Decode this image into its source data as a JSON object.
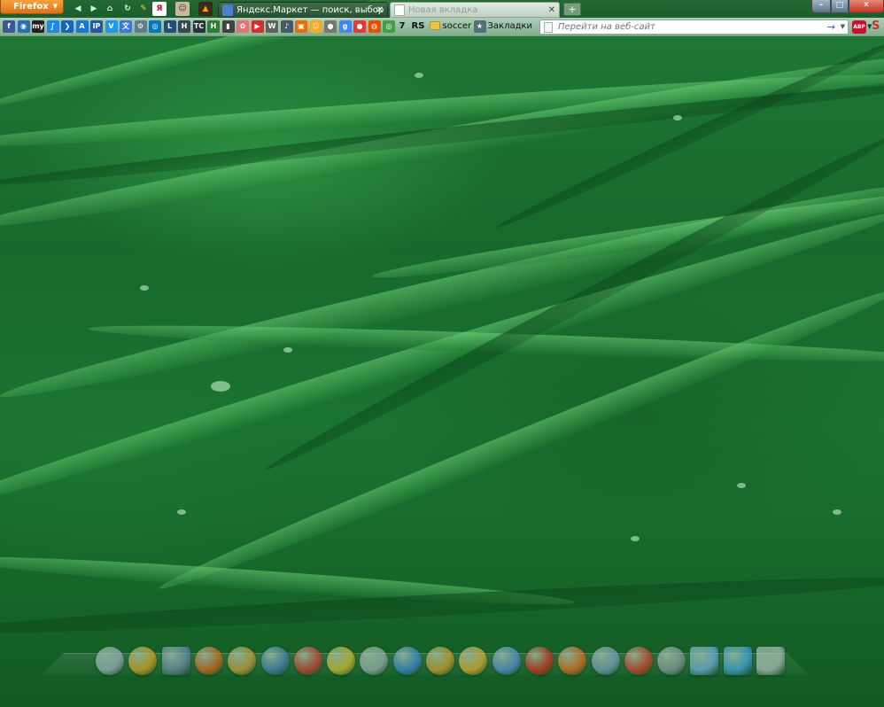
{
  "browser": {
    "app_button_label": "Firefox",
    "tabs": [
      {
        "label": "Яндекс.Маркет — поиск, выбор и п...",
        "active": false
      },
      {
        "label": "Новая вкладка",
        "active": true
      }
    ],
    "new_tab_symbol": "+",
    "window_controls": {
      "minimize": "–",
      "maximize": "□",
      "close": "✕"
    }
  },
  "toolbar": {
    "bookmark_icons": [
      {
        "name": "facebook-icon",
        "glyph": "f",
        "color": "#3b5998"
      },
      {
        "name": "globe-icon",
        "glyph": "◉",
        "color": "#2a6fb0"
      },
      {
        "name": "my-icon",
        "glyph": "my",
        "color": "#222222"
      },
      {
        "name": "swoosh-icon",
        "glyph": "∫",
        "color": "#1e88e5"
      },
      {
        "name": "arrow-icon",
        "glyph": "❯",
        "color": "#1565c0"
      },
      {
        "name": "a-icon",
        "glyph": "A",
        "color": "#1976d2"
      },
      {
        "name": "ip-icon",
        "glyph": "IP",
        "color": "#1e5aa8"
      },
      {
        "name": "v-icon",
        "glyph": "V",
        "color": "#2196f3"
      },
      {
        "name": "translate-icon",
        "glyph": "文",
        "color": "#3a7bd5"
      },
      {
        "name": "gear-icon",
        "glyph": "⚙",
        "color": "#607d8b"
      },
      {
        "name": "target-icon",
        "glyph": "◎",
        "color": "#0277bd"
      },
      {
        "name": "lj-icon",
        "glyph": "L",
        "color": "#1f4e79"
      },
      {
        "name": "h-icon",
        "glyph": "H",
        "color": "#37474f"
      },
      {
        "name": "tc-icon",
        "glyph": "TC",
        "color": "#263238"
      },
      {
        "name": "h-green-icon",
        "glyph": "H",
        "color": "#2e7d32"
      },
      {
        "name": "film-icon",
        "glyph": "▮",
        "color": "#424242"
      },
      {
        "name": "flower-icon",
        "glyph": "✿",
        "color": "#e57373"
      },
      {
        "name": "youtube-icon",
        "glyph": "▶",
        "color": "#d32f2f"
      },
      {
        "name": "wikipedia-icon",
        "glyph": "W",
        "color": "#616161"
      },
      {
        "name": "note-icon",
        "glyph": "♪",
        "color": "#455a64"
      },
      {
        "name": "picture-icon",
        "glyph": "▣",
        "color": "#ef6c00"
      },
      {
        "name": "smile-icon",
        "glyph": "☺",
        "color": "#f9a825"
      },
      {
        "name": "apple-icon",
        "glyph": "●",
        "color": "#757575"
      },
      {
        "name": "google-icon",
        "glyph": "g",
        "color": "#4285f4"
      },
      {
        "name": "red-dot-icon",
        "glyph": "●",
        "color": "#e53935"
      },
      {
        "name": "ubuntu-icon",
        "glyph": "◍",
        "color": "#e65100"
      },
      {
        "name": "chrome-icon",
        "glyph": "◎",
        "color": "#43a047"
      }
    ],
    "bookmark_texts": [
      {
        "name": "bookmark-7",
        "label": "7"
      },
      {
        "name": "bookmark-rs",
        "label": "RS"
      }
    ],
    "soccer_folder_label": "soccer",
    "bookmarks_menu_label": "Закладки",
    "address_bar": {
      "value": "",
      "placeholder": "Перейти на веб-сайт"
    },
    "go_symbol": "→",
    "adblock_label": "ABP",
    "extension_label": "S"
  },
  "dock": {
    "icons": [
      {
        "name": "finder-icon",
        "color": "#9ab0c0"
      },
      {
        "name": "chrome-icon",
        "color": "#d9a323"
      },
      {
        "name": "monitor-icon",
        "color": "#6a8aa8"
      },
      {
        "name": "firefox-icon",
        "color": "#d2691e"
      },
      {
        "name": "chrome-color-icon",
        "color": "#c9a13a"
      },
      {
        "name": "globe-icon",
        "color": "#4a7fb0"
      },
      {
        "name": "acrobat-icon",
        "color": "#d04030"
      },
      {
        "name": "aimp-icon",
        "color": "#d4c030"
      },
      {
        "name": "paper-plane-icon",
        "color": "#9ab0b0"
      },
      {
        "name": "ie-icon",
        "color": "#3a8ad0"
      },
      {
        "name": "thunderbird-icon",
        "color": "#d0a030"
      },
      {
        "name": "banana-icon",
        "color": "#e0b030"
      },
      {
        "name": "earth-icon",
        "color": "#5a90d0"
      },
      {
        "name": "opera-icon",
        "color": "#d03020"
      },
      {
        "name": "firefox-orange-icon",
        "color": "#e07020"
      },
      {
        "name": "chromium-icon",
        "color": "#7aa0c0"
      },
      {
        "name": "chrome-red-icon",
        "color": "#d84030"
      },
      {
        "name": "wordpress-icon",
        "color": "#8a9aa0"
      },
      {
        "name": "windows-icon",
        "color": "#70b0e0"
      },
      {
        "name": "skype-icon",
        "color": "#40a8e0"
      },
      {
        "name": "trash-icon",
        "color": "#b0c0b8"
      }
    ]
  }
}
